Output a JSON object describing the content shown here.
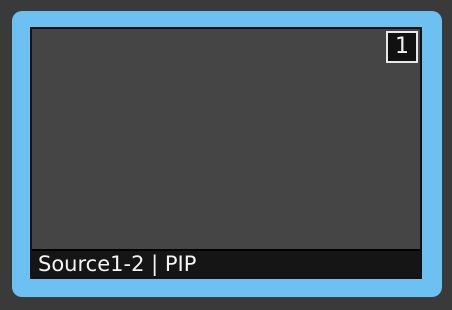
{
  "preview": {
    "window_number": "1",
    "source_label": "Source1-2 | PIP",
    "selected": true,
    "colors": {
      "selected_border": "#6cc1f2",
      "screen_background": "#454545",
      "label_background": "#151515",
      "text": "#f4f4f4",
      "page_background": "#3a3a3a"
    }
  }
}
